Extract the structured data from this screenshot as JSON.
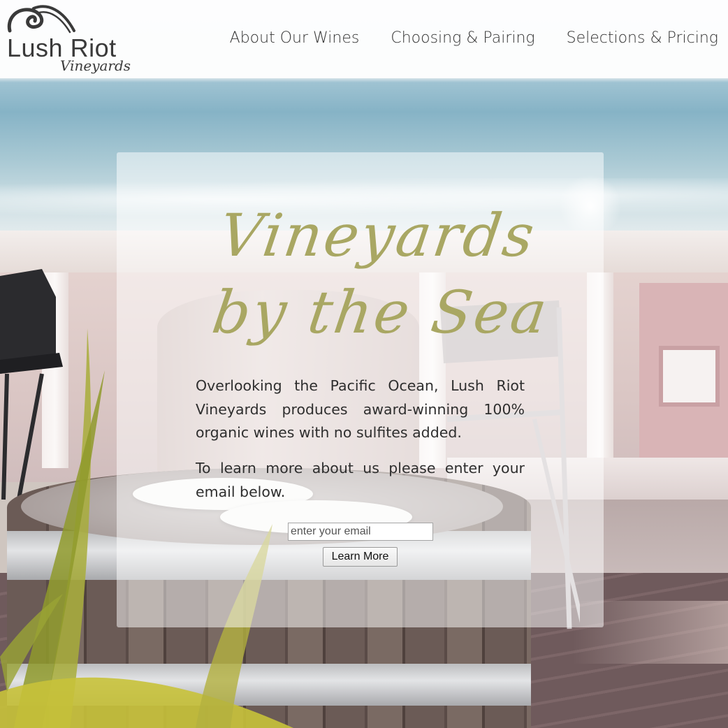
{
  "brand": {
    "name": "Lush Riot",
    "subname": "Vineyards"
  },
  "nav": {
    "items": [
      {
        "label": "About Our Wines"
      },
      {
        "label": "Choosing & Pairing"
      },
      {
        "label": "Selections & Pricing"
      }
    ]
  },
  "hero": {
    "title_line1": "Vineyards",
    "title_line2": "by the Sea",
    "paragraph1": "Overlooking the Pacific Ocean, Lush Riot Vineyards produces award-winning 100% organic wines with no sulfites added.",
    "paragraph2": "To learn more about us please enter your email below.",
    "email_placeholder": "enter your email",
    "email_value": "",
    "button_label": "Learn More"
  },
  "colors": {
    "title_accent": "#a9a763",
    "text": "#2e2e2e",
    "header_bg": "#ffffff"
  },
  "icons": {
    "logo_mark": "swirl-wave-icon"
  }
}
